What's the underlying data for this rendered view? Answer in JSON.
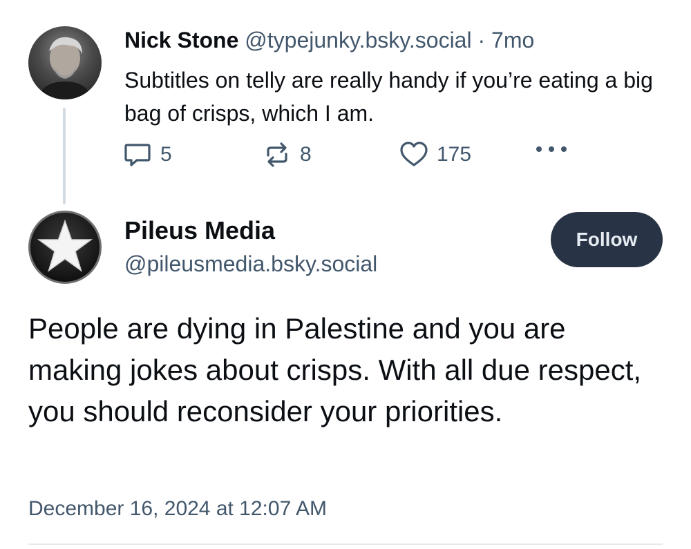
{
  "parent_post": {
    "author_name": "Nick Stone",
    "author_handle": "@typejunky.bsky.social",
    "separator": "·",
    "age": "7mo",
    "text": "Subtitles on telly are really handy if you’re eating a big bag of crisps, which I am.",
    "replies": "5",
    "reposts": "8",
    "likes": "175"
  },
  "main_post": {
    "author_name": "Pileus Media",
    "author_handle": "@pileusmedia.bsky.social",
    "follow_label": "Follow",
    "text": "People are dying in Palestine and you are making jokes about crisps. With all due respect, you should reconsider your priorities.",
    "timestamp": "December 16, 2024 at 12:07 AM"
  },
  "icons": {
    "reply": "reply-bubble-icon",
    "repost": "repost-arrows-icon",
    "like": "heart-icon",
    "more": "more-dots-icon",
    "avatar_star": "star-icon"
  },
  "colors": {
    "text_primary": "#0b0f14",
    "text_secondary": "#42576c",
    "follow_bg": "#283445",
    "thread_line": "#d3dbe3"
  }
}
